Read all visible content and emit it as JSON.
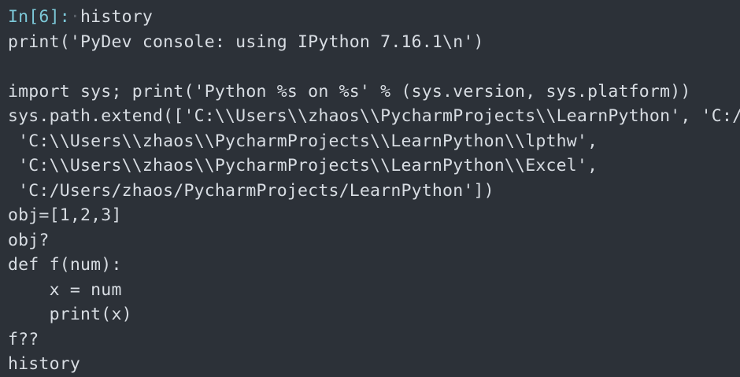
{
  "console": {
    "prompt": "In[6]:",
    "lines": [
      "history",
      "print('PyDev console: using IPython 7.16.1\\n')",
      "",
      "import sys; print('Python %s on %s' % (sys.version, sys.platform))",
      "sys.path.extend(['C:\\\\Users\\\\zhaos\\\\PycharmProjects\\\\LearnPython', 'C:/Users/zhaos/PycharmProjects/LearnPython',",
      " 'C:\\\\Users\\\\zhaos\\\\PycharmProjects\\\\LearnPython\\\\lpthw',",
      " 'C:\\\\Users\\\\zhaos\\\\PycharmProjects\\\\LearnPython\\\\Excel',",
      " 'C:/Users/zhaos/PycharmProjects/LearnPython'])",
      "obj=[1,2,3]",
      "obj?",
      "def f(num):",
      "    x = num",
      "    print(x)",
      "f??",
      "history"
    ]
  },
  "colors": {
    "background": "#2c3138",
    "text": "#d8dde3",
    "prompt": "#7cc8d8",
    "whitespace_marker": "#5a6068"
  }
}
